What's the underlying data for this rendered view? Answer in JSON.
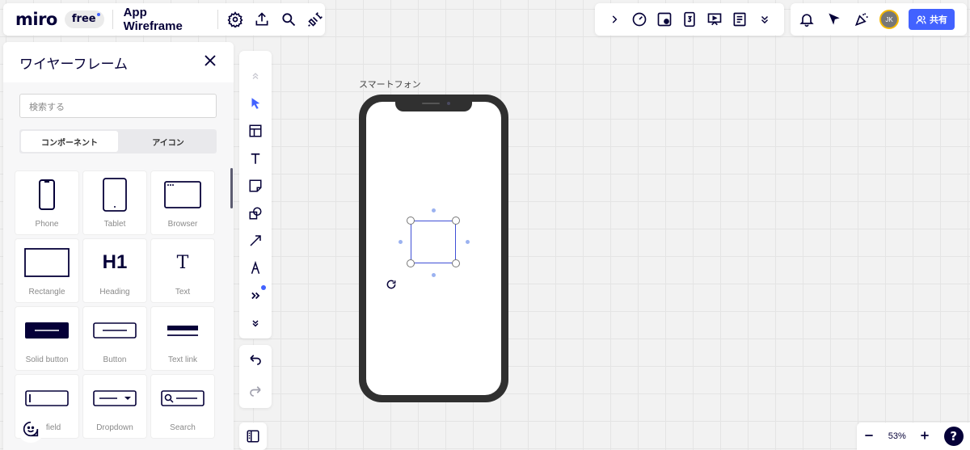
{
  "header": {
    "logo": "miro",
    "plan_badge": "free",
    "board_title": "App Wireframe"
  },
  "share": {
    "label": "共有"
  },
  "user": {
    "initials": "JK"
  },
  "wireframe_panel": {
    "title": "ワイヤーフレーム",
    "search_placeholder": "検索する",
    "tabs": [
      {
        "label": "コンポーネント",
        "active": true
      },
      {
        "label": "アイコン",
        "active": false
      }
    ],
    "tiles": [
      {
        "label": "Phone",
        "icon": "phone-icon"
      },
      {
        "label": "Tablet",
        "icon": "tablet-icon"
      },
      {
        "label": "Browser",
        "icon": "browser-icon"
      },
      {
        "label": "Rectangle",
        "icon": "rectangle-icon"
      },
      {
        "label": "Heading",
        "icon": "heading-icon",
        "glyph": "H1"
      },
      {
        "label": "Text",
        "icon": "text-icon",
        "glyph": "T"
      },
      {
        "label": "Solid button",
        "icon": "solid-button-icon"
      },
      {
        "label": "Button",
        "icon": "button-icon"
      },
      {
        "label": "Text link",
        "icon": "text-link-icon"
      },
      {
        "label": "ext field",
        "icon": "text-field-icon"
      },
      {
        "label": "Dropdown",
        "icon": "dropdown-icon"
      },
      {
        "label": "Search",
        "icon": "search-field-icon"
      }
    ]
  },
  "canvas": {
    "frame_label": "スマートフォン"
  },
  "zoom": {
    "level": "53%"
  },
  "colors": {
    "accent": "#4262ff",
    "ink": "#050038",
    "phone": "#303030"
  }
}
